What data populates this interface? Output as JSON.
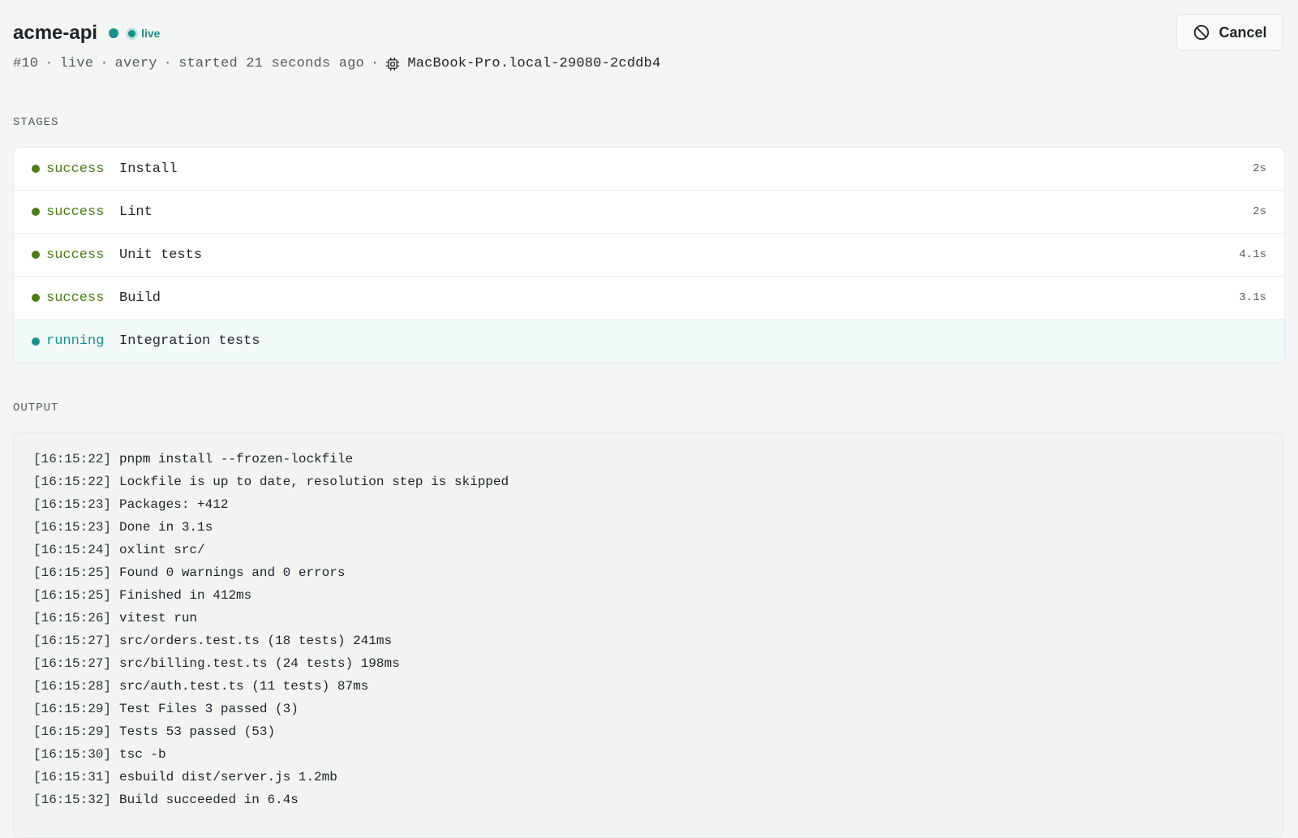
{
  "header": {
    "title": "acme-api",
    "live_label": "live",
    "cancel_label": "Cancel",
    "meta": {
      "run_number": "#10",
      "status": "live",
      "user": "avery",
      "started": "started 21 seconds ago",
      "host": "MacBook-Pro.local-29080-2cddb4",
      "separator": "·"
    }
  },
  "colors": {
    "success": "#4d7c1a",
    "running": "#1a9188",
    "accent": "#1a9188"
  },
  "icons": {
    "status_dot": "status-dot",
    "cancel": "ban-circle-icon",
    "host": "chip-icon"
  },
  "stages": {
    "label": "STAGES",
    "items": [
      {
        "status": "success",
        "name": "Install",
        "duration": "2s"
      },
      {
        "status": "success",
        "name": "Lint",
        "duration": "2s"
      },
      {
        "status": "success",
        "name": "Unit tests",
        "duration": "4.1s"
      },
      {
        "status": "success",
        "name": "Build",
        "duration": "3.1s"
      },
      {
        "status": "running",
        "name": "Integration tests",
        "duration": ""
      }
    ]
  },
  "output": {
    "label": "OUTPUT",
    "lines": [
      {
        "time": "[16:15:22]",
        "text": "pnpm install --frozen-lockfile"
      },
      {
        "time": "[16:15:22]",
        "text": "Lockfile is up to date, resolution step is skipped"
      },
      {
        "time": "[16:15:23]",
        "text": "Packages: +412"
      },
      {
        "time": "[16:15:23]",
        "text": "Done in 3.1s"
      },
      {
        "time": "[16:15:24]",
        "text": "oxlint src/"
      },
      {
        "time": "[16:15:25]",
        "text": "Found 0 warnings and 0 errors"
      },
      {
        "time": "[16:15:25]",
        "text": "Finished in 412ms"
      },
      {
        "time": "[16:15:26]",
        "text": "vitest run"
      },
      {
        "time": "[16:15:27]",
        "text": "src/orders.test.ts (18 tests) 241ms"
      },
      {
        "time": "[16:15:27]",
        "text": "src/billing.test.ts (24 tests) 198ms"
      },
      {
        "time": "[16:15:28]",
        "text": "src/auth.test.ts (11 tests) 87ms"
      },
      {
        "time": "[16:15:29]",
        "text": "Test Files 3 passed (3)"
      },
      {
        "time": "[16:15:29]",
        "text": "Tests 53 passed (53)"
      },
      {
        "time": "[16:15:30]",
        "text": "tsc -b"
      },
      {
        "time": "[16:15:31]",
        "text": "esbuild dist/server.js 1.2mb"
      },
      {
        "time": "[16:15:32]",
        "text": "Build succeeded in 6.4s"
      }
    ]
  }
}
